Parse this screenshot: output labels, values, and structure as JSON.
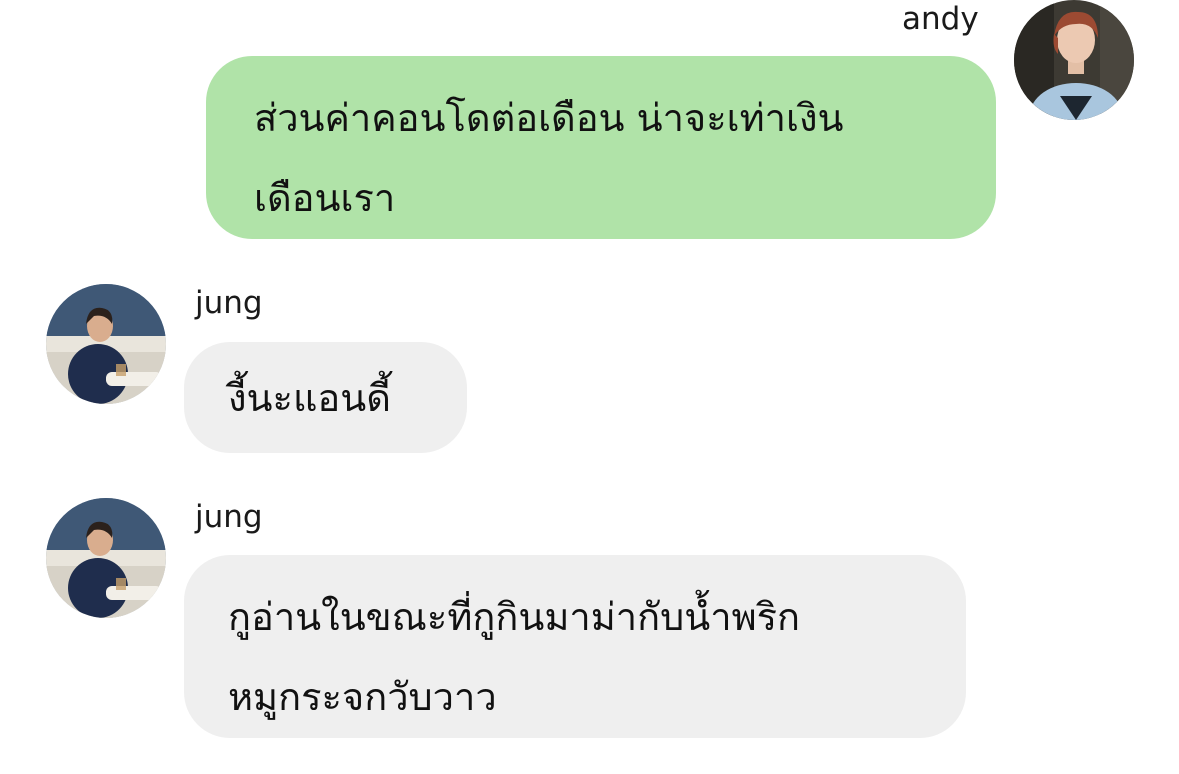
{
  "messages": [
    {
      "sender": "andy",
      "direction": "outgoing",
      "lines": [
        "ส่วนค่าคอนโดต่อเดือน น่าจะเท่าเงิน",
        "เดือนเรา"
      ],
      "bubble_color": "#b0e3a8"
    },
    {
      "sender": "jung",
      "direction": "incoming",
      "lines": [
        "งี้นะแอนดี้"
      ],
      "bubble_color": "#efefef"
    },
    {
      "sender": "jung",
      "direction": "incoming",
      "lines": [
        "กูอ่านในขณะที่กูกินมาม่ากับน้ำพริก",
        "หมูกระจกวับวาว"
      ],
      "bubble_color": "#efefef"
    }
  ],
  "avatars": {
    "andy": "avatar-andy",
    "jung": "avatar-jung"
  }
}
